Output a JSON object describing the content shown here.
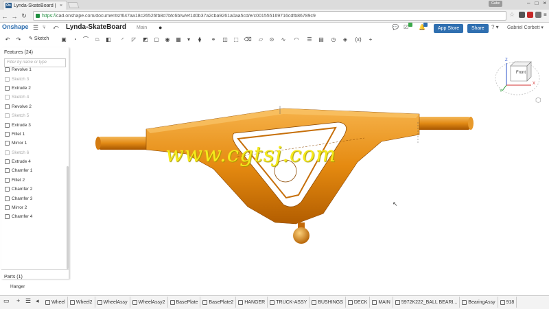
{
  "browser": {
    "tab_title": "Lynda-SkateBoard |",
    "tab_close": "×",
    "user_badge": "Gabe",
    "url_https": "https://",
    "url_rest": "cad.onshape.com/documents/f647aa18c26526fb8d7bfc6b/w/ef1d0b37a2cba9261a0aa5cd/e/c001555169716cdfb86789c9",
    "win_min": "–",
    "win_max": "□",
    "win_close": "×"
  },
  "app": {
    "logo": "Onshape",
    "doc_title": "Lynda-SkateBoard",
    "branch": "Main",
    "app_store": "App Store",
    "share": "Share",
    "user": "Gabriel Corbett ▾",
    "help": "? ▾"
  },
  "toolbar": {
    "sketch_label": "Sketch"
  },
  "features": {
    "title": "Features (24)",
    "filter_placeholder": "Filter by name or type",
    "items": [
      {
        "label": "Revolve 1",
        "sketch": false
      },
      {
        "label": "Sketch 3",
        "sketch": true
      },
      {
        "label": "Extrude 2",
        "sketch": false
      },
      {
        "label": "Sketch 4",
        "sketch": true
      },
      {
        "label": "Revolve 2",
        "sketch": false
      },
      {
        "label": "Sketch 5",
        "sketch": true
      },
      {
        "label": "Extrude 3",
        "sketch": false
      },
      {
        "label": "Fillet 1",
        "sketch": false
      },
      {
        "label": "Mirror 1",
        "sketch": false
      },
      {
        "label": "Sketch 6",
        "sketch": true
      },
      {
        "label": "Extrude 4",
        "sketch": false
      },
      {
        "label": "Chamfer 1",
        "sketch": false
      },
      {
        "label": "Fillet 2",
        "sketch": false
      },
      {
        "label": "Chamfer 2",
        "sketch": false
      },
      {
        "label": "Chamfer 3",
        "sketch": false
      },
      {
        "label": "Mirror 2",
        "sketch": false
      },
      {
        "label": "Chamfer 4",
        "sketch": false
      }
    ]
  },
  "parts": {
    "title": "Parts (1)",
    "items": [
      "Hanger"
    ]
  },
  "viewcube": {
    "face": "Front",
    "z": "Z",
    "x": "X",
    "y": "Y"
  },
  "watermark": "www.cgtsj.com",
  "bottom_tabs": [
    "Wheel",
    "Wheel2",
    "WheelAssy",
    "WheelAssy2",
    "BasePlate",
    "BasePlate2",
    "HANGER",
    "TRUCK-ASSY",
    "BUSHINGS",
    "DECK",
    "MAIN",
    "5972K222_BALL BEARI...",
    "BearingAssy",
    "918"
  ],
  "colors": {
    "onshape_blue": "#2f6fb0",
    "part_orange": "#e58a10"
  }
}
